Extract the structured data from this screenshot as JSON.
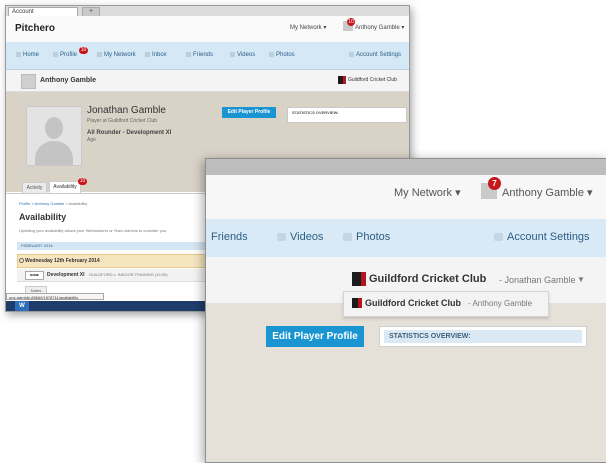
{
  "small_window": {
    "browser_tab": "Account",
    "new_tab": "+",
    "logo": "Pitchero",
    "my_network": "My Network ▾",
    "user_badge": "10",
    "user_name": "Anthony Gamble ▾",
    "nav": [
      "Home",
      "Profile",
      "My Network",
      "Inbox",
      "Friends",
      "Videos",
      "Photos",
      "Account Settings"
    ],
    "profile_badge": "10",
    "subhead_name": "Anthony Gamble",
    "club_name": "Guildford Cricket Club",
    "profile": {
      "name": "Jonathan Gamble",
      "subtitle": "Player at Guildford Cricket Club",
      "role": "All Rounder - Development XI",
      "age": "Age"
    },
    "edit_button": "Edit Player Profile",
    "stats_label": "STATISTICS OVERVIEW:",
    "tabs": {
      "activity": "Activity",
      "availability": "Availability",
      "availability_badge": "10"
    },
    "breadcrumb": {
      "link": "Profile » Anthony Gamble",
      "current": " » Availability"
    },
    "heading": "Availability",
    "description": "Updating your availability allows your Webmasters or Team Admins to consider you",
    "month": "FEBRUARY 2014",
    "day": "Wednesday 12th February 2014",
    "not_set": "Not Se",
    "event_tag": "NONE",
    "event_team": "Development XI",
    "event_desc": "GUILDFORD v. INDOOR TRAINING (19:30)",
    "notes": "Notes",
    "status_url": "ony-gamble-85669/1578711/availability"
  },
  "zoom_window": {
    "my_network": "My Network ▾",
    "badge": "7",
    "user_name": "Anthony Gamble ▾",
    "nav": [
      {
        "label": "Friends",
        "icon": "friends"
      },
      {
        "label": "Videos",
        "icon": "video-icon"
      },
      {
        "label": "Photos",
        "icon": "photo-icon"
      },
      {
        "label": "Account Settings",
        "icon": "gear-icon"
      }
    ],
    "club_name": "Guildford Cricket Club",
    "club_person": "- Jonathan Gamble",
    "caret": "▼",
    "dropdown_club": "Guildford Cricket Club",
    "dropdown_person": "- Anthony Gamble",
    "edit_button": "Edit Player Profile",
    "stats_label": "STATISTICS OVERVIEW:"
  }
}
